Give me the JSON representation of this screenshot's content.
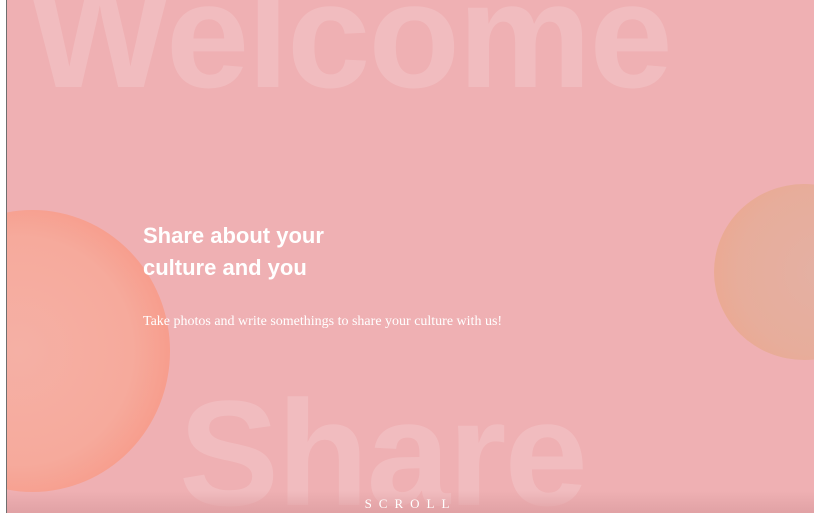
{
  "hero": {
    "bg_word_top": "Welcome",
    "bg_word_bottom": "Share",
    "headline_line1": "Share about your",
    "headline_line2": "culture and you",
    "subtext": "Take photos and write somethings to share your culture with us!",
    "scroll_label": "SCROLL"
  },
  "colors": {
    "background": "#efb0b3",
    "circle_left": "#f6aa9c",
    "circle_right": "#e7ad9b",
    "text": "#ffffff"
  }
}
